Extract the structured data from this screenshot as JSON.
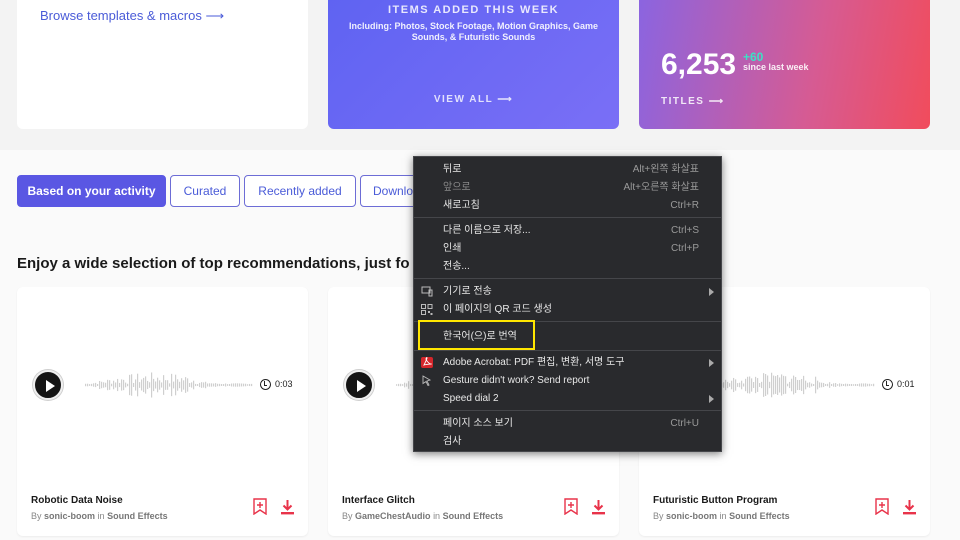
{
  "top_cards": {
    "browse_link": "Browse templates & macros ⟶",
    "items_heading": "ITEMS ADDED THIS WEEK",
    "items_sub": "Including: Photos, Stock Footage, Motion Graphics, Game Sounds, & Futuristic Sounds",
    "view_all": "VIEW ALL ⟶",
    "titles_count": "6,253",
    "plus_count": "+60",
    "since_text": "since last week",
    "titles_link": "TITLES ⟶"
  },
  "filters": [
    "Based on your activity",
    "Curated",
    "Recently added",
    "Downlo"
  ],
  "section_title": "Enjoy a wide selection of top recommendations, just fo",
  "sounds": [
    {
      "title": "Robotic Data Noise",
      "by": "By",
      "author": "sonic-boom",
      "in": "in",
      "category": "Sound Effects",
      "duration": "0:03"
    },
    {
      "title": "Interface Glitch",
      "by": "By",
      "author": "GameChestAudio",
      "in": "in",
      "category": "Sound Effects",
      "duration": ""
    },
    {
      "title": "Futuristic Button Program",
      "by": "By",
      "author": "sonic-boom",
      "in": "in",
      "category": "Sound Effects",
      "duration": "0:01"
    }
  ],
  "context_menu": {
    "items": [
      {
        "label": "뒤로",
        "shortcut": "Alt+왼쪽 화살표"
      },
      {
        "label": "앞으로",
        "shortcut": "Alt+오른쪽 화살표"
      },
      {
        "label": "새로고침",
        "shortcut": "Ctrl+R"
      },
      {
        "label": "다른 이름으로 저장...",
        "shortcut": "Ctrl+S"
      },
      {
        "label": "인쇄",
        "shortcut": "Ctrl+P"
      },
      {
        "label": "전송...",
        "shortcut": ""
      },
      {
        "label": "기기로 전송",
        "shortcut": ""
      },
      {
        "label": "이 페이지의 QR 코드 생성",
        "shortcut": ""
      },
      {
        "label": "한국어(으)로 번역",
        "shortcut": ""
      },
      {
        "label": "Adobe Acrobat: PDF 편집, 변환, 서명 도구",
        "shortcut": ""
      },
      {
        "label": "Gesture didn't work? Send report",
        "shortcut": ""
      },
      {
        "label": "Speed dial 2",
        "shortcut": ""
      },
      {
        "label": "페이지 소스 보기",
        "shortcut": "Ctrl+U"
      },
      {
        "label": "검사",
        "shortcut": ""
      }
    ]
  },
  "colors": {
    "accent": "#5a57e3",
    "danger": "#e8334a",
    "menu_bg": "#292a2d",
    "highlight": "#ffe600"
  }
}
